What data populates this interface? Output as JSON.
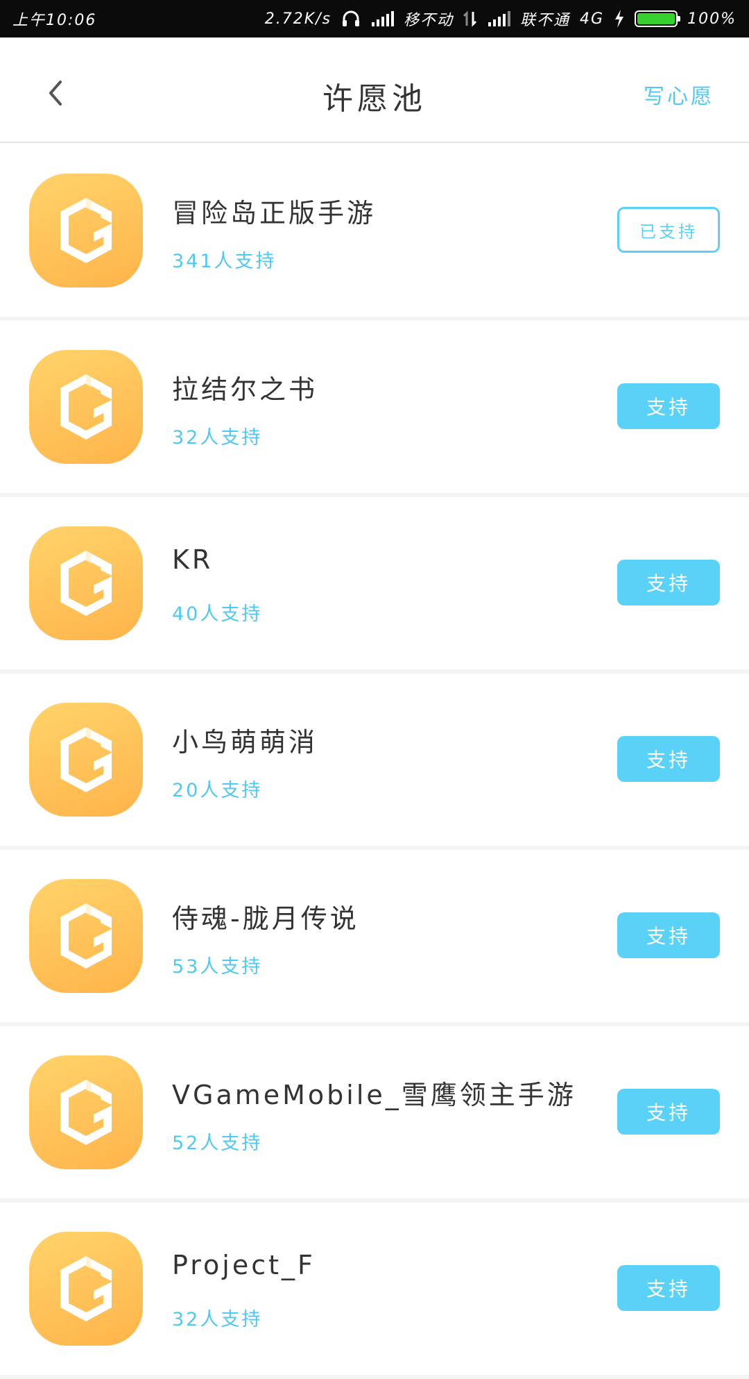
{
  "status_bar": {
    "time": "上午10:06",
    "speed": "2.72K/s",
    "carrier1": "移不动",
    "carrier2": "联不通",
    "network": "4G",
    "battery_text": "100%",
    "battery_level": 100,
    "battery_color": "#36d12f"
  },
  "header": {
    "title": "许愿池",
    "action_label": "写心愿",
    "back_icon": "chevron-left-icon"
  },
  "colors": {
    "accent": "#4fc8f2",
    "button": "#5ad2f8",
    "icon_gradient_start": "#ffd36a",
    "icon_gradient_end": "#ffb44a"
  },
  "items": [
    {
      "name": "冒险岛正版手游",
      "count": "341人支持",
      "button": "已支持",
      "supported": true
    },
    {
      "name": "拉结尔之书",
      "count": "32人支持",
      "button": "支持",
      "supported": false
    },
    {
      "name": "KR",
      "count": "40人支持",
      "button": "支持",
      "supported": false
    },
    {
      "name": "小鸟萌萌消",
      "count": "20人支持",
      "button": "支持",
      "supported": false
    },
    {
      "name": "侍魂-胧月传说",
      "count": "53人支持",
      "button": "支持",
      "supported": false
    },
    {
      "name": "VGameMobile_雪鹰领主手游",
      "count": "52人支持",
      "button": "支持",
      "supported": false
    },
    {
      "name": "Project_F",
      "count": "32人支持",
      "button": "支持",
      "supported": false
    }
  ]
}
